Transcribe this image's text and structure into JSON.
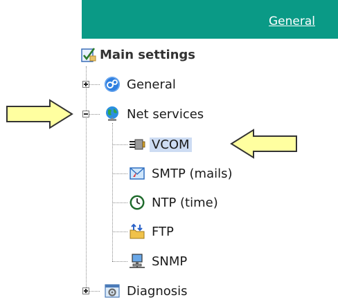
{
  "header": {
    "link_label": "General"
  },
  "tree": {
    "root": {
      "label": "Main settings",
      "icon": "settings-checklist-icon"
    },
    "items": [
      {
        "label": "General",
        "icon": "gears-icon",
        "expander": "plus"
      },
      {
        "label": "Net services",
        "icon": "globe-icon",
        "expander": "minus",
        "children": [
          {
            "label": "VCOM",
            "icon": "serial-connector-icon",
            "selected": true
          },
          {
            "label": "SMTP (mails)",
            "icon": "mail-server-icon"
          },
          {
            "label": "NTP (time)",
            "icon": "clock-icon"
          },
          {
            "label": "FTP",
            "icon": "ftp-folder-icon"
          },
          {
            "label": "SNMP",
            "icon": "network-computer-icon"
          }
        ]
      },
      {
        "label": "Diagnosis",
        "icon": "diagnosis-icon",
        "expander": "plus"
      }
    ]
  },
  "colors": {
    "header_bg": "#0a9a86",
    "selected_bg": "#cddcf3",
    "arrow_fill": "#ffffa0"
  }
}
